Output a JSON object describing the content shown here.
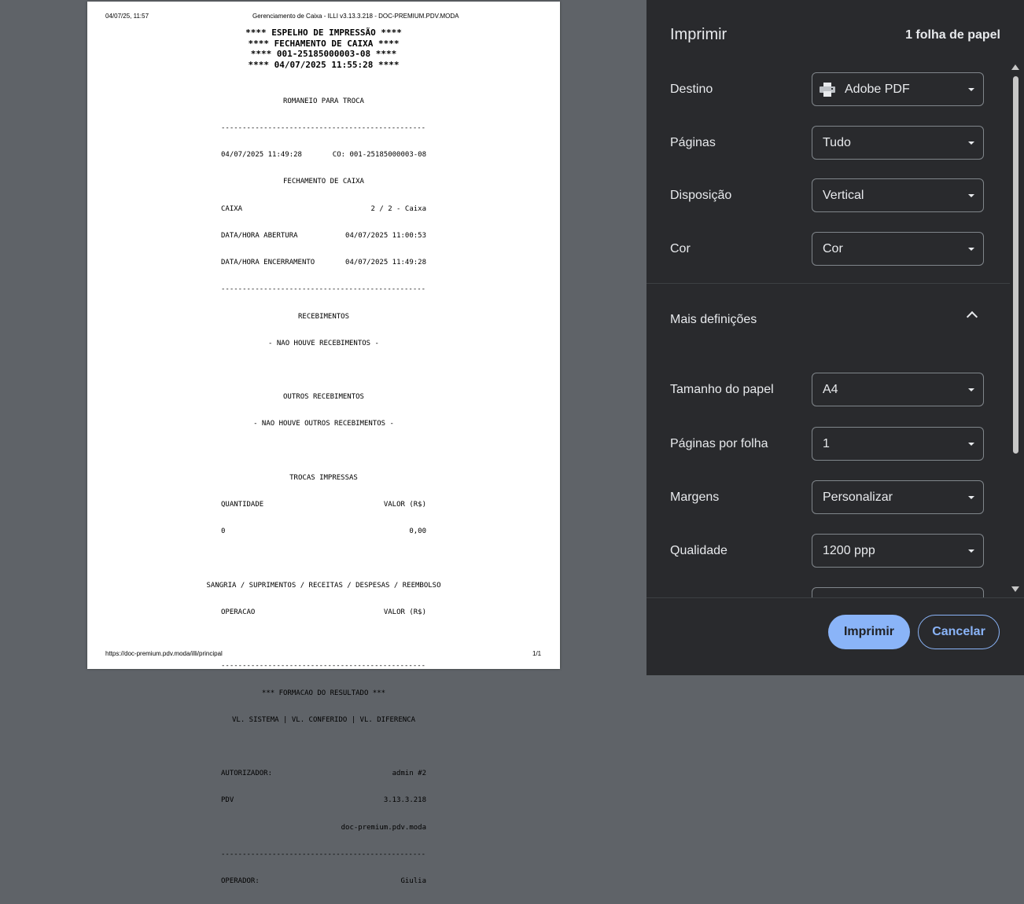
{
  "preview": {
    "header_left": "04/07/25, 11:57",
    "header_center": "Gerenciamento de Caixa - ILLI v3.13.3.218 - DOC-PREMIUM.PDV.MODA",
    "footer_left": "https://doc-premium.pdv.moda/illi/principal",
    "footer_right": "1/1",
    "receipt": {
      "title_lines": [
        "**** ESPELHO DE IMPRESSÃO ****",
        "**** FECHAMENTO DE CAIXA ****",
        "**** 001-25185000003-08 ****",
        "**** 04/07/2025 11:55:28 ****"
      ],
      "romaneio": "ROMANEIO PARA TROCA",
      "separator": "------------------------------------------------------------",
      "datetime": "04/07/2025 11:49:28",
      "co": "CO: 001-25185000003-08",
      "fechamento": "FECHAMENTO DE CAIXA",
      "caixa_label": "CAIXA",
      "caixa_value": "2 / 2 - Caixa",
      "abertura_label": "DATA/HORA ABERTURA",
      "abertura_value": "04/07/2025 11:00:53",
      "encerramento_label": "DATA/HORA ENCERRAMENTO",
      "encerramento_value": "04/07/2025 11:49:28",
      "recebimentos": "RECEBIMENTOS",
      "nao_recebimentos": "- NAO HOUVE RECEBIMENTOS -",
      "outros": "OUTROS RECEBIMENTOS",
      "nao_outros": "- NAO HOUVE OUTROS RECEBIMENTOS -",
      "trocas": "TROCAS IMPRESSAS",
      "quantidade_label": "QUANTIDADE",
      "valor_label": "VALOR (R$)",
      "quantidade_value": "0",
      "valor_value": "0,00",
      "sangria": "SANGRIA / SUPRIMENTOS / RECEITAS / DESPESAS / REEMBOLSO",
      "operacao_label": "OPERACAO",
      "formacao": "*** FORMACAO DO RESULTADO ***",
      "vl_line": "VL. SISTEMA | VL. CONFERIDO | VL. DIFERENCA",
      "autorizador_label": "AUTORIZADOR:",
      "autorizador_value": "admin #2",
      "pdv_label": "PDV",
      "pdv_value": "3.13.3.218",
      "pdv_host": "doc-premium.pdv.moda",
      "operador_label": "OPERADOR:",
      "operador_value": "Giulia"
    }
  },
  "panel": {
    "title": "Imprimir",
    "sheets": "1 folha de papel",
    "settings": [
      {
        "label": "Destino",
        "value": "Adobe PDF",
        "icon": "printer-icon"
      },
      {
        "label": "Páginas",
        "value": "Tudo"
      },
      {
        "label": "Disposição",
        "value": "Vertical"
      },
      {
        "label": "Cor",
        "value": "Cor"
      }
    ],
    "more_settings": "Mais definições",
    "more": [
      {
        "label": "Tamanho do papel",
        "value": "A4"
      },
      {
        "label": "Páginas por folha",
        "value": "1"
      },
      {
        "label": "Margens",
        "value": "Personalizar"
      },
      {
        "label": "Qualidade",
        "value": "1200 ppp"
      }
    ],
    "print_button": "Imprimir",
    "cancel_button": "Cancelar"
  },
  "colors": {
    "panel_bg": "#292a2d",
    "preview_bg": "#5f6368",
    "accent": "#8ab4f8"
  }
}
